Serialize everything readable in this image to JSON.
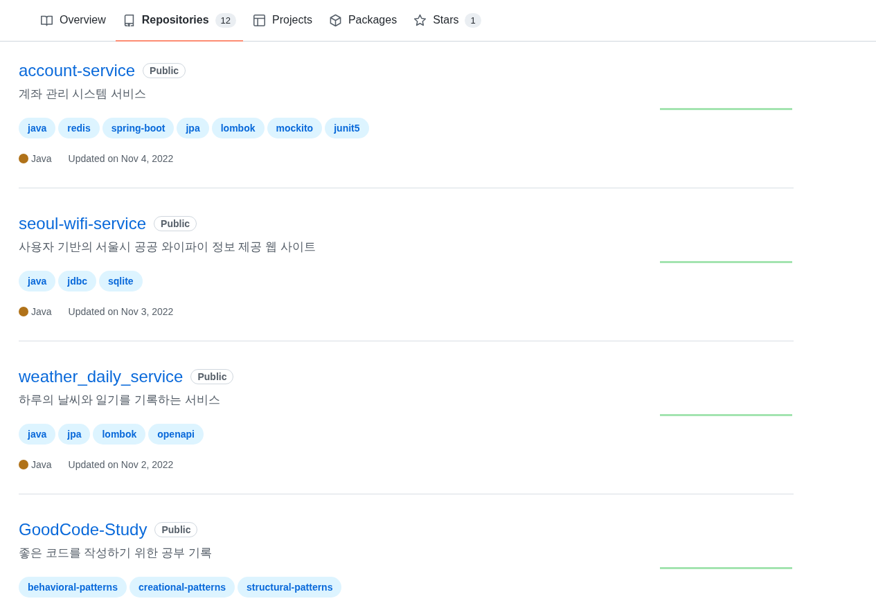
{
  "tabs": [
    {
      "kind": "book",
      "label": "Overview",
      "selected": false
    },
    {
      "kind": "repo",
      "label": "Repositories",
      "count": "12",
      "selected": true
    },
    {
      "kind": "table",
      "label": "Projects",
      "selected": false
    },
    {
      "kind": "package",
      "label": "Packages",
      "selected": false
    },
    {
      "kind": "star",
      "label": "Stars",
      "count": "1",
      "selected": false
    }
  ],
  "repositories": [
    {
      "name": "account-service",
      "visibility": "Public",
      "description": "계좌 관리 시스템 서비스",
      "topics": [
        "java",
        "redis",
        "spring-boot",
        "jpa",
        "lombok",
        "mockito",
        "junit5"
      ],
      "language": "Java",
      "color": "#b07219",
      "updated": "Updated on Nov 4, 2022"
    },
    {
      "name": "seoul-wifi-service",
      "visibility": "Public",
      "description": "사용자 기반의 서울시 공공 와이파이 정보 제공 웹 사이트",
      "topics": [
        "java",
        "jdbc",
        "sqlite"
      ],
      "language": "Java",
      "color": "#b07219",
      "updated": "Updated on Nov 3, 2022"
    },
    {
      "name": "weather_daily_service",
      "visibility": "Public",
      "description": "하루의 날씨와 일기를 기록하는 서비스",
      "topics": [
        "java",
        "jpa",
        "lombok",
        "openapi"
      ],
      "language": "Java",
      "color": "#b07219",
      "updated": "Updated on Nov 2, 2022"
    },
    {
      "name": "GoodCode-Study",
      "visibility": "Public",
      "description": "좋은 코드를 작성하기 위한 공부 기록",
      "topics": [
        "behavioral-patterns",
        "creational-patterns",
        "structural-patterns"
      ]
    }
  ]
}
